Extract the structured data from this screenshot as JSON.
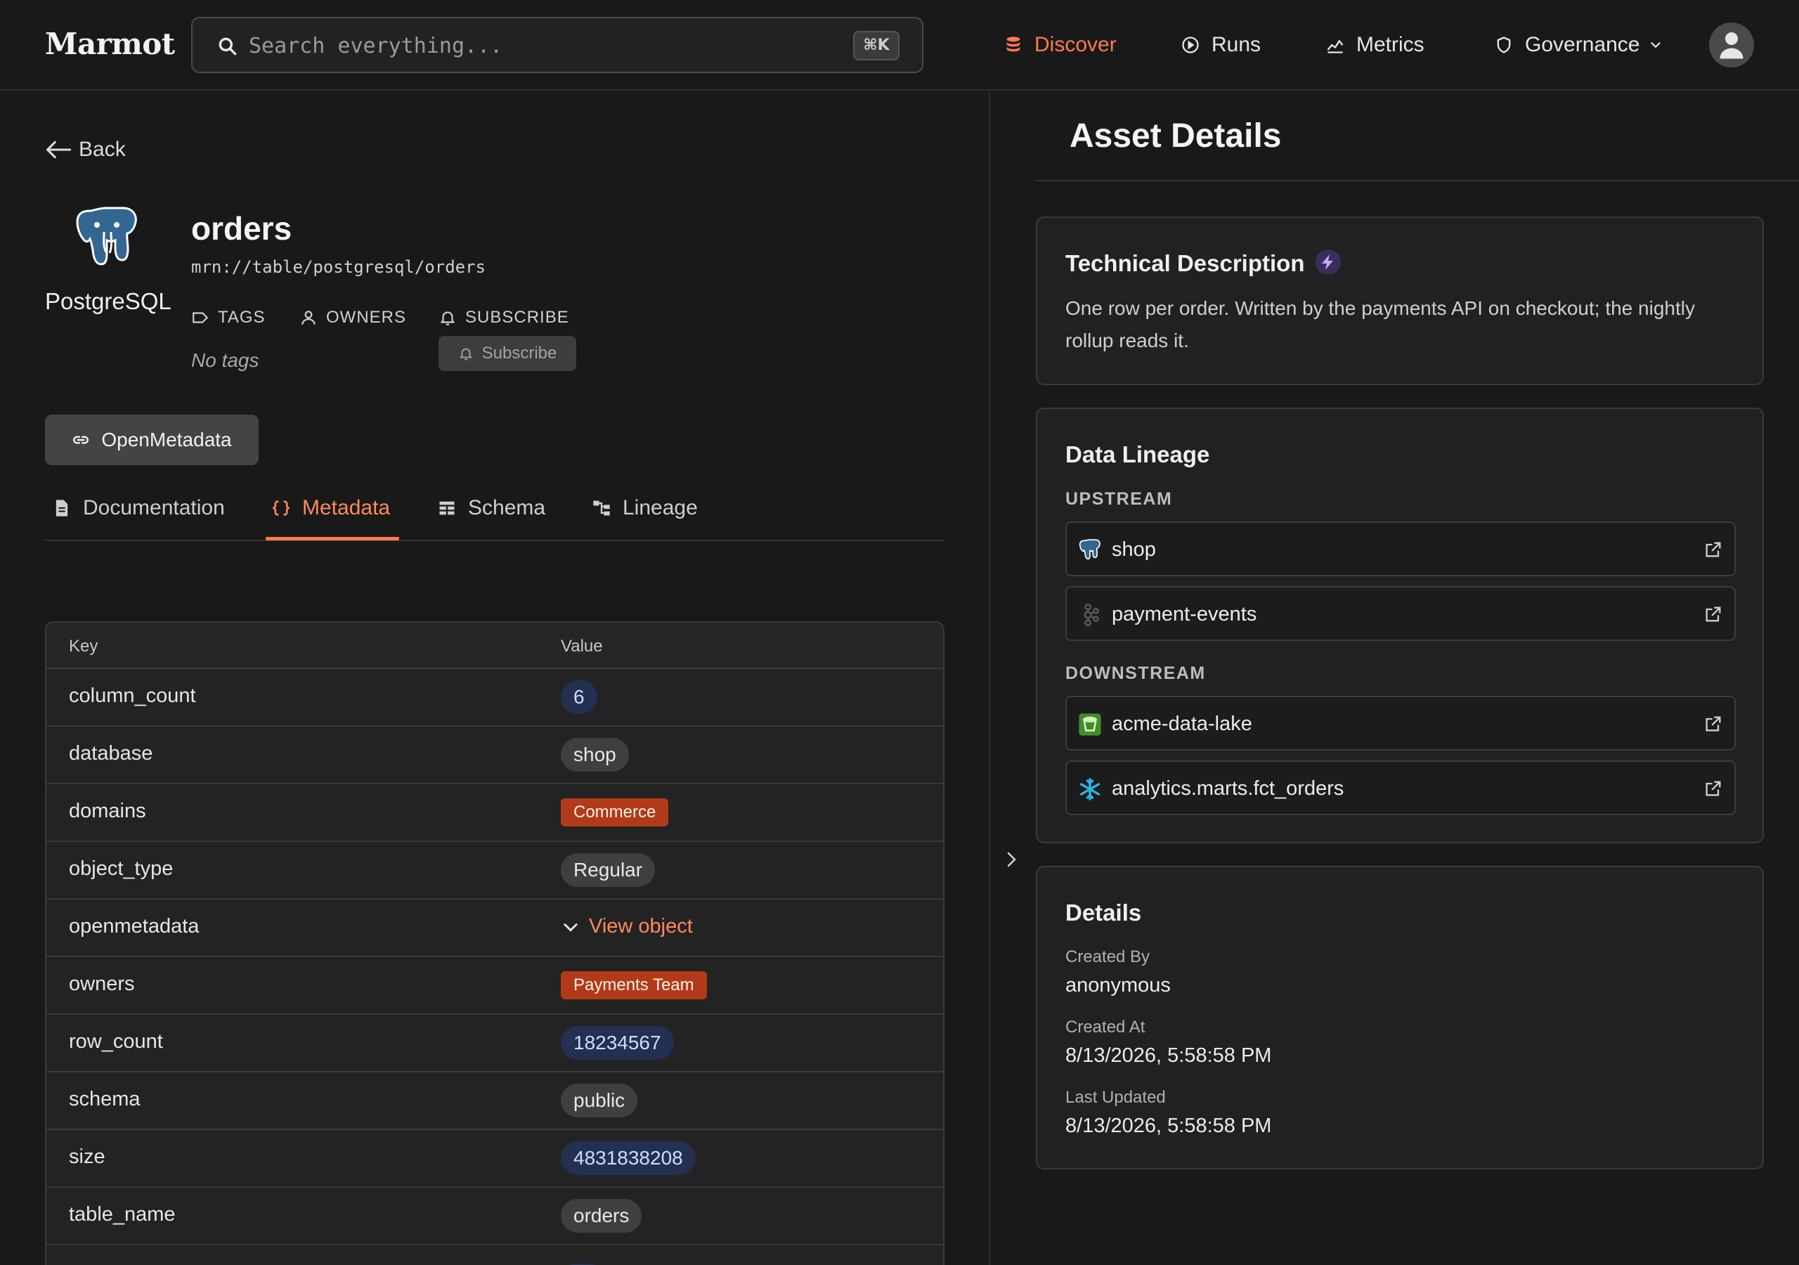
{
  "nav": {
    "brand": "Marmot",
    "search_placeholder": "Search everything...",
    "search_shortcut": "⌘K",
    "items": [
      {
        "label": "Discover",
        "icon": "database-icon",
        "active": true
      },
      {
        "label": "Runs",
        "icon": "play-circle-icon"
      },
      {
        "label": "Metrics",
        "icon": "chart-icon"
      },
      {
        "label": "Governance",
        "icon": "shield-icon",
        "dropdown": true
      }
    ],
    "accent_color": "#ff7a4d"
  },
  "asset": {
    "back_label": "Back",
    "platform": "PostgreSQL",
    "name": "orders",
    "mrn": "mrn://table/postgresql/orders",
    "tags_label": "TAGS",
    "owners_label": "OWNERS",
    "subscribe_label": "SUBSCRIBE",
    "no_tags": "No tags",
    "subscribe_button": "Subscribe",
    "source_button": "OpenMetadata"
  },
  "tabs": [
    {
      "label": "Documentation",
      "icon": "document-icon"
    },
    {
      "label": "Metadata",
      "icon": "braces-icon",
      "active": true
    },
    {
      "label": "Schema",
      "icon": "table-icon"
    },
    {
      "label": "Lineage",
      "icon": "lineage-icon"
    }
  ],
  "metadata_table": {
    "headers": {
      "key": "Key",
      "value": "Value"
    },
    "rows": [
      {
        "key": "column_count",
        "value": "6",
        "style": "num"
      },
      {
        "key": "database",
        "value": "shop",
        "style": "gray"
      },
      {
        "key": "domains",
        "value": "Commerce",
        "style": "red"
      },
      {
        "key": "object_type",
        "value": "Regular",
        "style": "gray"
      },
      {
        "key": "openmetadata",
        "value": "View object",
        "style": "link"
      },
      {
        "key": "owners",
        "value": "Payments Team",
        "style": "red"
      },
      {
        "key": "row_count",
        "value": "18234567",
        "style": "num"
      },
      {
        "key": "schema",
        "value": "public",
        "style": "gray"
      },
      {
        "key": "size",
        "value": "4831838208",
        "style": "num"
      },
      {
        "key": "table_name",
        "value": "orders",
        "style": "gray"
      }
    ]
  },
  "details_panel": {
    "title": "Asset Details",
    "technical_description": {
      "title": "Technical Description",
      "text": "One row per order. Written by the payments API on checkout; the nightly rollup reads it."
    },
    "lineage": {
      "title": "Data Lineage",
      "upstream_label": "UPSTREAM",
      "downstream_label": "DOWNSTREAM",
      "upstream": [
        {
          "name": "shop",
          "icon": "postgresql-icon"
        },
        {
          "name": "payment-events",
          "icon": "kafka-icon"
        }
      ],
      "downstream": [
        {
          "name": "acme-data-lake",
          "icon": "s3-bucket-icon"
        },
        {
          "name": "analytics.marts.fct_orders",
          "icon": "snowflake-icon"
        }
      ]
    },
    "details": {
      "title": "Details",
      "created_by_label": "Created By",
      "created_by": "anonymous",
      "created_at_label": "Created At",
      "created_at": "8/13/2026, 5:58:58 PM",
      "updated_label": "Last Updated",
      "updated_at": "8/13/2026, 5:58:58 PM"
    }
  }
}
